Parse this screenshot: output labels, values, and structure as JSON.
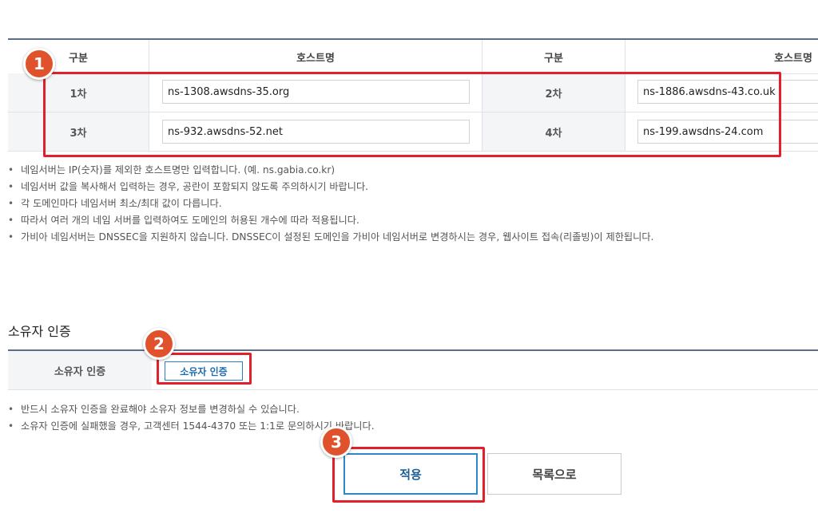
{
  "ns_table": {
    "headers": [
      "구분",
      "호스트명",
      "구분",
      "호스트명"
    ],
    "rows": [
      {
        "label1": "1차",
        "value1": "ns-1308.awsdns-35.org",
        "label2": "2차",
        "value2": "ns-1886.awsdns-43.co.uk"
      },
      {
        "label1": "3차",
        "value1": "ns-932.awsdns-52.net",
        "label2": "4차",
        "value2": "ns-199.awsdns-24.com"
      }
    ]
  },
  "ns_notes": [
    "네임서버는 IP(숫자)를 제외한 호스트명만 입력합니다. (예. ns.gabia.co.kr)",
    "네임서버 값을 복사해서 입력하는 경우, 공란이 포함되지 않도록 주의하시기 바랍니다.",
    "각 도메인마다 네임서버 최소/최대 값이 다릅니다.",
    "따라서 여러 개의 네임 서버를 입력하여도 도메인의 허용된 개수에 따라 적용됩니다.",
    "가비아 네임서버는 DNSSEC을 지원하지 않습니다. DNSSEC이 설정된 도메인을 가비아 네임서버로 변경하시는 경우, 웹사이트 접속(리졸빙)이 제한됩니다."
  ],
  "owner": {
    "section_title": "소유자 인증",
    "row_label": "소유자 인증",
    "button_label": "소유자 인증"
  },
  "owner_notes": [
    "반드시 소유자 인증을 완료해야 소유자 정보를 변경하실 수 있습니다.",
    "소유자 인증에 실패했을 경우, 고객센터 1544-4370 또는 1:1로 문의하시기 바랍니다."
  ],
  "actions": {
    "apply_label": "적용",
    "list_label": "목록으로"
  },
  "annotations": {
    "badge1": "1",
    "badge2": "2",
    "badge3": "3",
    "highlight_color": "#e2202c",
    "badge_color": "#e0522b"
  }
}
